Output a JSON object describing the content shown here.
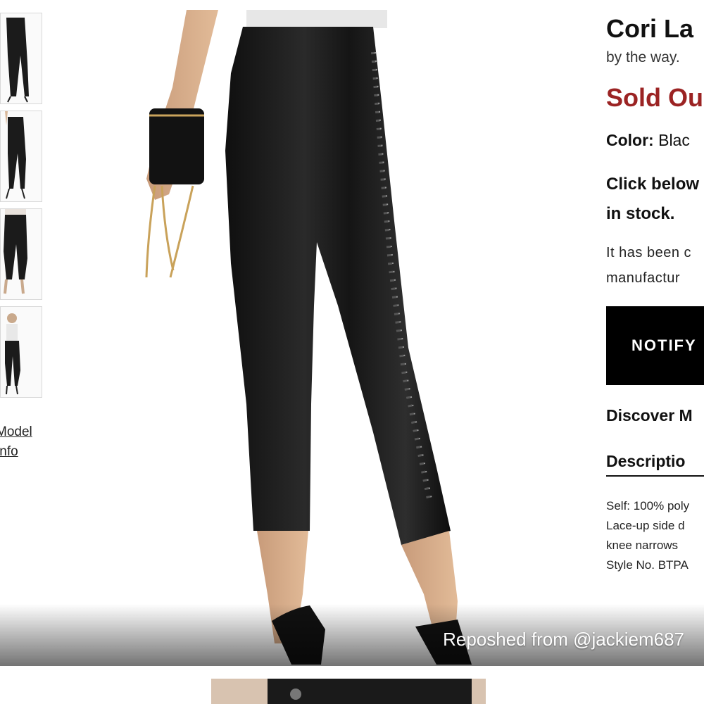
{
  "product": {
    "title": "Cori La",
    "brand": "by the way.",
    "price": "Sold Ou",
    "color_label": "Color:",
    "color_value": "Blac",
    "click_below_line1": "Click below",
    "click_below_line2": "in stock.",
    "note_line1": "It has been c",
    "note_line2": "manufactur",
    "notify_button": "NOTIFY",
    "discover": "Discover M",
    "description_heading": "Descriptio",
    "description_lines": [
      "Self: 100% poly",
      "Lace-up side d",
      "knee narrows",
      "Style No. BTPA"
    ]
  },
  "gallery": {
    "model_info_line1": "Model",
    "model_info_line2": "Info"
  },
  "repost": "Reposhed from @jackiem687",
  "colors": {
    "sold_out": "#9b2323",
    "button_bg": "#000000",
    "button_text": "#ffffff"
  }
}
